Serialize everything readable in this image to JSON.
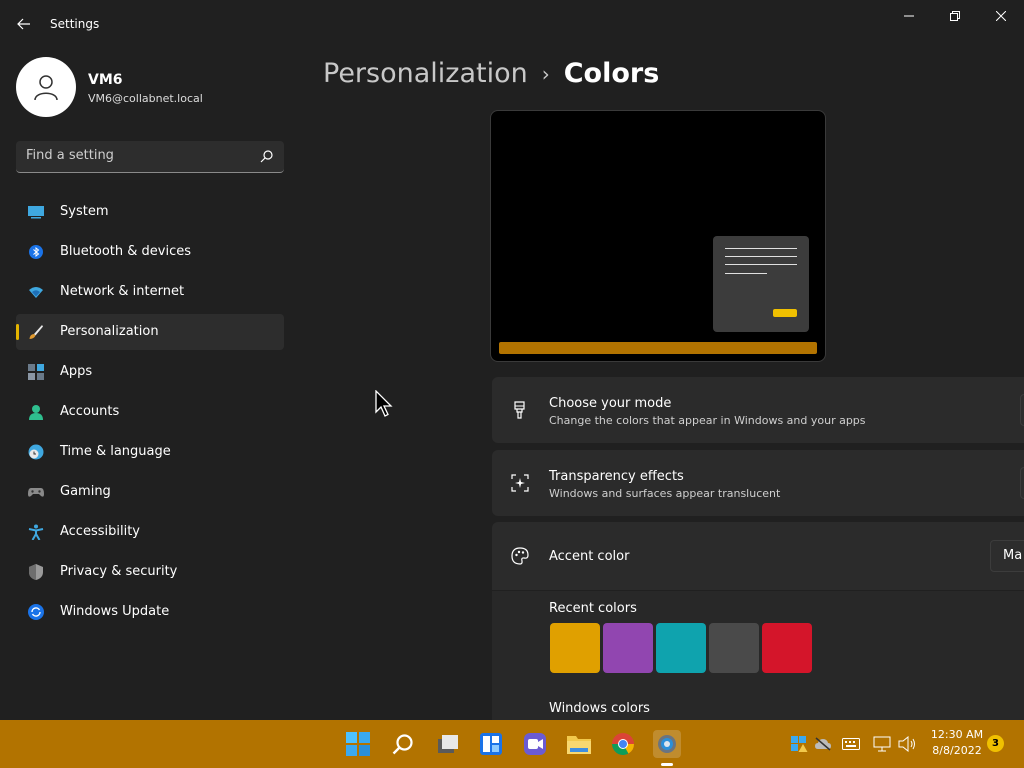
{
  "window": {
    "title": "Settings",
    "controls": {
      "minimize": "─",
      "maximize": "❐",
      "close": "✕"
    }
  },
  "profile": {
    "name": "VM6",
    "email": "VM6@collabnet.local"
  },
  "search": {
    "placeholder": "Find a setting"
  },
  "nav": {
    "items": [
      {
        "label": "System",
        "icon": "system-icon"
      },
      {
        "label": "Bluetooth & devices",
        "icon": "bluetooth-icon"
      },
      {
        "label": "Network & internet",
        "icon": "wifi-icon"
      },
      {
        "label": "Personalization",
        "icon": "brush-icon",
        "active": true
      },
      {
        "label": "Apps",
        "icon": "apps-icon"
      },
      {
        "label": "Accounts",
        "icon": "accounts-icon"
      },
      {
        "label": "Time & language",
        "icon": "clock-globe-icon"
      },
      {
        "label": "Gaming",
        "icon": "gamepad-icon"
      },
      {
        "label": "Accessibility",
        "icon": "accessibility-icon"
      },
      {
        "label": "Privacy & security",
        "icon": "shield-icon"
      },
      {
        "label": "Windows Update",
        "icon": "update-icon"
      }
    ]
  },
  "header": {
    "parent": "Personalization",
    "separator": "›",
    "current": "Colors"
  },
  "settings": {
    "mode": {
      "title": "Choose your mode",
      "desc": "Change the colors that appear in Windows and your apps"
    },
    "transparency": {
      "title": "Transparency effects",
      "desc": "Windows and surfaces appear translucent"
    },
    "accent": {
      "title": "Accent color",
      "dropdown_value": "Ma"
    },
    "recent_label": "Recent colors",
    "windows_label": "Windows colors",
    "recent_colors": [
      "#e0a000",
      "#9146b0",
      "#0fa3ae",
      "#4a4a4a",
      "#d4152a"
    ]
  },
  "theme": {
    "accent": "#e3b400",
    "taskbar": "#b27300",
    "background": "#202020"
  },
  "taskbar": {
    "apps": [
      "windows-start-icon",
      "search-icon",
      "task-view-icon",
      "widgets-icon",
      "teams-chat-icon",
      "file-explorer-icon",
      "chrome-icon",
      "settings-icon"
    ],
    "time": "12:30 AM",
    "date": "8/8/2022",
    "notifications": "3"
  }
}
